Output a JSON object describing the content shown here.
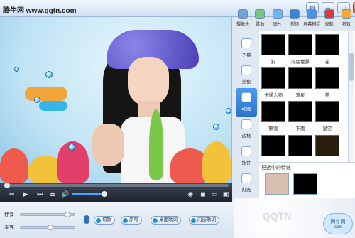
{
  "header": {
    "site_text": "腾牛网 www.qqtn.com"
  },
  "toolbar": {
    "items": [
      {
        "label": "摄像头",
        "icon": "camera-icon",
        "color": "#6da3d9"
      },
      {
        "label": "歌曲",
        "icon": "music-note-icon",
        "color": "#75c77a"
      },
      {
        "label": "图片",
        "icon": "picture-icon",
        "color": "#6cb6f2"
      },
      {
        "label": "视频",
        "icon": "video-icon",
        "color": "#3f82d1"
      },
      {
        "label": "屏幕捕捉",
        "icon": "screen-capture-icon",
        "color": "#4b92e6"
      },
      {
        "label": "录制",
        "icon": "record-icon",
        "color": "#d33c3c"
      },
      {
        "label": "特效",
        "icon": "effects-icon",
        "color": "#f0a93a"
      }
    ]
  },
  "sidebar": {
    "tabs": [
      {
        "label": "字幕",
        "icon": "subtitle-icon"
      },
      {
        "label": "美化",
        "icon": "beautify-icon"
      },
      {
        "label": "动画",
        "icon": "animation-icon",
        "active": true
      },
      {
        "label": "边框",
        "icon": "frame-icon"
      },
      {
        "label": "挂件",
        "icon": "pendant-icon"
      },
      {
        "label": "灯光",
        "icon": "light-icon"
      }
    ]
  },
  "effects": {
    "items": [
      {
        "caption": "狗"
      },
      {
        "caption": "海底世界"
      },
      {
        "caption": "花"
      },
      {
        "caption": "卡通人物"
      },
      {
        "caption": "流星"
      },
      {
        "caption": "猫"
      },
      {
        "caption": "飘雪"
      },
      {
        "caption": "下雨"
      },
      {
        "caption": "星空"
      }
    ],
    "chosen_title": "已选中的特效"
  },
  "controls": {
    "play": "▶",
    "prev": "⏮",
    "next": "⏭",
    "eject": "⏏",
    "volume_icon": "🔊"
  },
  "bottom": {
    "accompany_label": "伴奏",
    "mic_label": "麦克",
    "buttons": [
      "切歌",
      "原唱",
      "桌面歌词",
      "内嵌歌词"
    ]
  },
  "branding": {
    "logo_text": "QQTN",
    "badge_line1": "腾牛网",
    "badge_line2": ".com"
  },
  "colors": {
    "accent": "#2b74cb"
  }
}
